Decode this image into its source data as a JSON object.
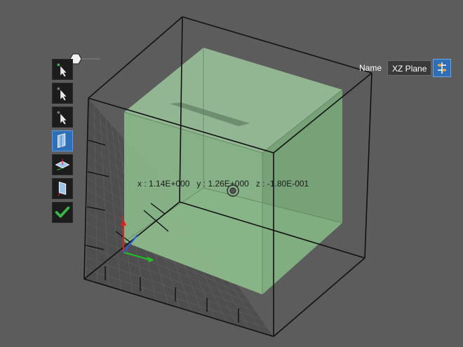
{
  "toolbar": {
    "tools": [
      {
        "name": "select-tool-1",
        "icon": "cursor-arrow-icon",
        "active": false
      },
      {
        "name": "select-tool-2",
        "icon": "cursor-arrow-icon",
        "active": false
      },
      {
        "name": "select-tool-3",
        "icon": "cursor-arrow-icon",
        "active": false
      },
      {
        "name": "front-plane-tool",
        "icon": "vertical-plane-icon",
        "active": true
      },
      {
        "name": "horizontal-plane-tool",
        "icon": "horizontal-plane-icon",
        "active": false
      },
      {
        "name": "side-plane-tool",
        "icon": "side-plane-icon",
        "active": false
      },
      {
        "name": "confirm-tool",
        "icon": "check-icon",
        "active": false
      }
    ]
  },
  "name_panel": {
    "label": "Name",
    "value": "XZ Plane",
    "button_icon": "plane-settings-icon"
  },
  "coordinates": {
    "x_label": "x :",
    "x_value": "1.14E+000",
    "y_label": "y :",
    "y_value": "1.26E+000",
    "z_label": "z :",
    "z_value": "-1.80E-001"
  },
  "colors": {
    "background": "#5c5c5c",
    "box_fill": "#8fbf8f",
    "accent_blue": "#2f6fb8",
    "check_green": "#39b54a"
  }
}
